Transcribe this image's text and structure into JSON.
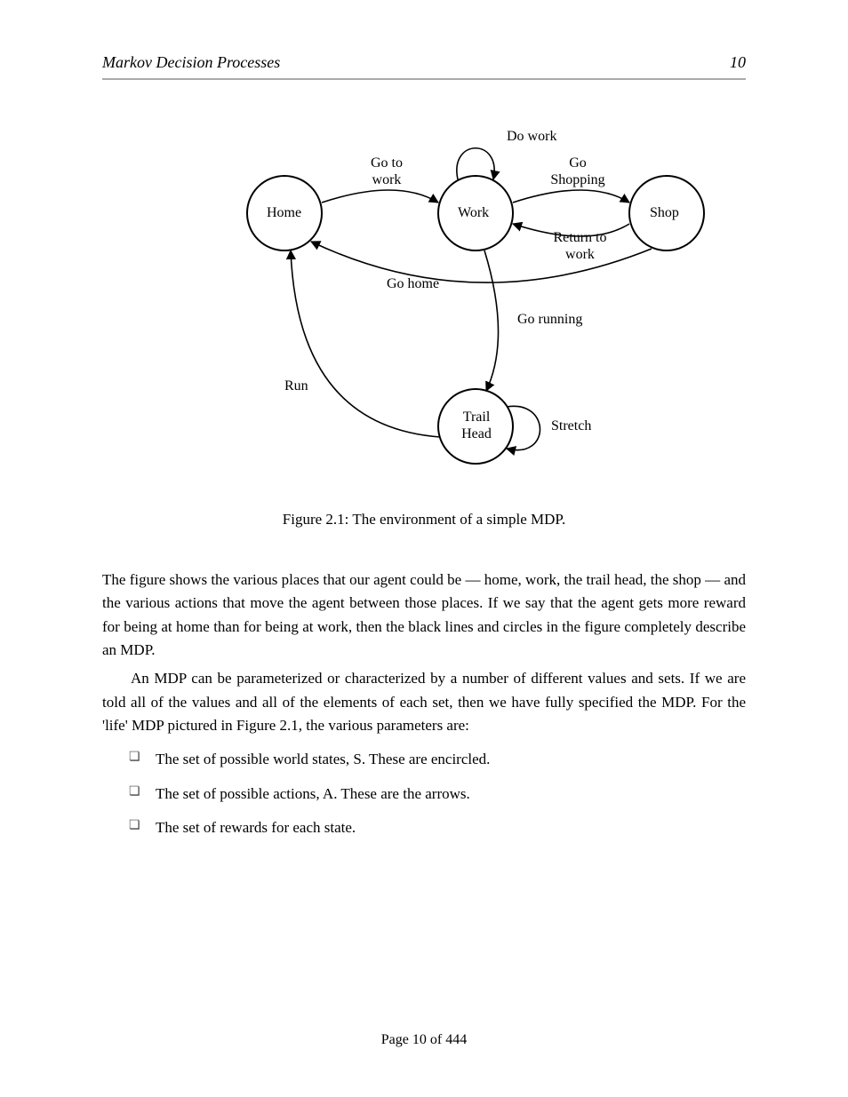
{
  "header": {
    "left": "Markov Decision Processes",
    "right": "10"
  },
  "diagram": {
    "nodes": {
      "home": {
        "label": "Home"
      },
      "work": {
        "label": "Work"
      },
      "shop": {
        "label": "Shop"
      },
      "trail": {
        "label": "Trail\nHead"
      }
    },
    "edges": {
      "home_work": {
        "label": "Go to\nwork"
      },
      "work_shop": {
        "label": "Go\nShopping"
      },
      "work_work": {
        "label": "Do work"
      },
      "shop_work": {
        "label": "Return to\nwork"
      },
      "shop_home": {
        "label": "Go home"
      },
      "work_trail": {
        "label": "Go running"
      },
      "trail_home": {
        "label": "Run"
      },
      "trail_trail": {
        "label": "Stretch"
      }
    }
  },
  "caption": "Figure 2.1: The environment of a simple MDP.",
  "text": {
    "p1": "The figure shows the various places that our agent could be — home, work, the trail head, the shop — and the various actions that move the agent between those places. If we say that the agent gets more reward for being at home than for being at work, then the black lines and circles in the figure completely describe an MDP.",
    "p2": "An MDP can be parameterized or characterized by a number of different values and sets. If we are told all of the values and all of the elements of each set, then we have fully specified the MDP. For the 'life' MDP pictured in Figure 2.1, the various parameters are:"
  },
  "bullets": [
    "The set of possible world states, S. These are encircled.",
    "The set of possible actions, A. These are the arrows.",
    "The set of rewards for each state."
  ],
  "footer": "Page 10 of 444"
}
